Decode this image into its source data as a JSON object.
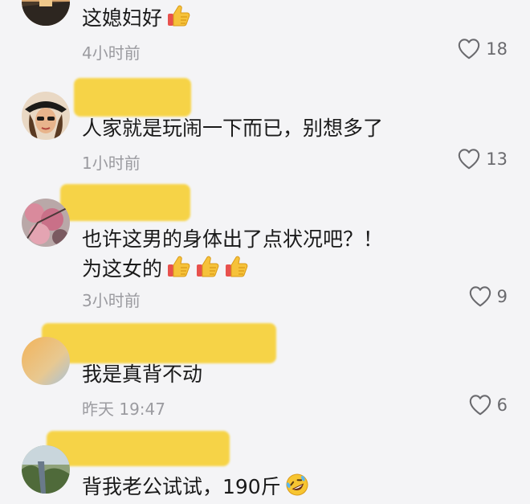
{
  "comments": [
    {
      "text": "这媳妇好",
      "emoji": [
        "thumbs-up"
      ],
      "time": "4小时前",
      "likes": "18"
    },
    {
      "text": "人家就是玩闹一下而已，别想多了",
      "time": "1小时前",
      "likes": "13"
    },
    {
      "text_line1": "也许这男的身体出了点状况吧？！",
      "text_line2": "为这女的",
      "emoji": [
        "thumbs-up",
        "thumbs-up",
        "thumbs-up"
      ],
      "time": "3小时前",
      "likes": "9"
    },
    {
      "text": "我是真背不动",
      "time": "昨天 19:47",
      "likes": "6"
    },
    {
      "text": "背我老公试试，190斤",
      "emoji": [
        "rolling-laughing"
      ]
    }
  ],
  "icons": {
    "like": "heart-outline-icon",
    "thumbs": "thumbs-up-emoji",
    "laugh": "rolling-on-floor-laughing-emoji"
  },
  "colors": {
    "background": "#f4f4f6",
    "redaction": "#f7d23e",
    "text": "#1a1a1a",
    "meta": "#9b9ba0"
  }
}
